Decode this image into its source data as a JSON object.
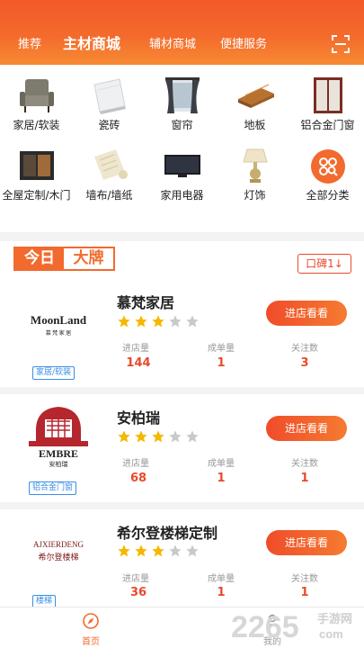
{
  "header": {
    "tabs": [
      "推荐",
      "主材商城",
      "辅材商城",
      "便捷服务"
    ],
    "active_tab": "主材商城",
    "scan_icon": "scan-icon"
  },
  "categories": [
    {
      "label": "家居/软装",
      "icon": "sofa-chair-icon"
    },
    {
      "label": "瓷砖",
      "icon": "tile-icon"
    },
    {
      "label": "窗帘",
      "icon": "curtain-icon"
    },
    {
      "label": "地板",
      "icon": "wood-floor-icon"
    },
    {
      "label": "铝合金门窗",
      "icon": "window-frame-icon"
    },
    {
      "label": "全屋定制/木门",
      "icon": "cabinet-icon"
    },
    {
      "label": "墙布/墙纸",
      "icon": "wallpaper-icon"
    },
    {
      "label": "家用电器",
      "icon": "tv-icon"
    },
    {
      "label": "灯饰",
      "icon": "lamp-icon"
    },
    {
      "label": "全部分类",
      "icon": "all-categories-icon"
    }
  ],
  "section": {
    "badge_a": "今日",
    "badge_b": "大牌",
    "sort_label": "口碑1↓"
  },
  "stat_labels": {
    "visits": "进店量",
    "orders": "成单量",
    "follows": "关注数"
  },
  "enter_label": "进店看看",
  "stores": [
    {
      "name": "慕梵家居",
      "logo_en": "MoonLand",
      "logo_cn": "慕 梵 家 居",
      "tag": "家居/软装",
      "rating": 3,
      "visits": "144",
      "orders": "1",
      "follows": "3"
    },
    {
      "name": "安柏瑞",
      "logo_en": "EMBRE",
      "logo_cn": "安柏瑞",
      "tag": "铝合金门窗",
      "rating": 3,
      "visits": "68",
      "orders": "1",
      "follows": "1"
    },
    {
      "name": "希尔登楼梯定制",
      "logo_en": "AJXIERDENG",
      "logo_cn": "希尔登楼梯",
      "tag": "楼梯",
      "rating": 3,
      "visits": "36",
      "orders": "1",
      "follows": "1"
    }
  ],
  "bottom_nav": [
    {
      "label": "首页",
      "icon": "compass-icon",
      "active": true
    },
    {
      "label": "我的",
      "icon": "user-icon",
      "active": false
    }
  ],
  "watermark": {
    "number": "2265",
    "suffix": "com",
    "cn": "手游网"
  },
  "colors": {
    "accent": "#f26a2e",
    "stat": "#e84a2a",
    "tag": "#3a8ee6",
    "star_on": "#f5b700",
    "star_off": "#c9c9c9"
  }
}
